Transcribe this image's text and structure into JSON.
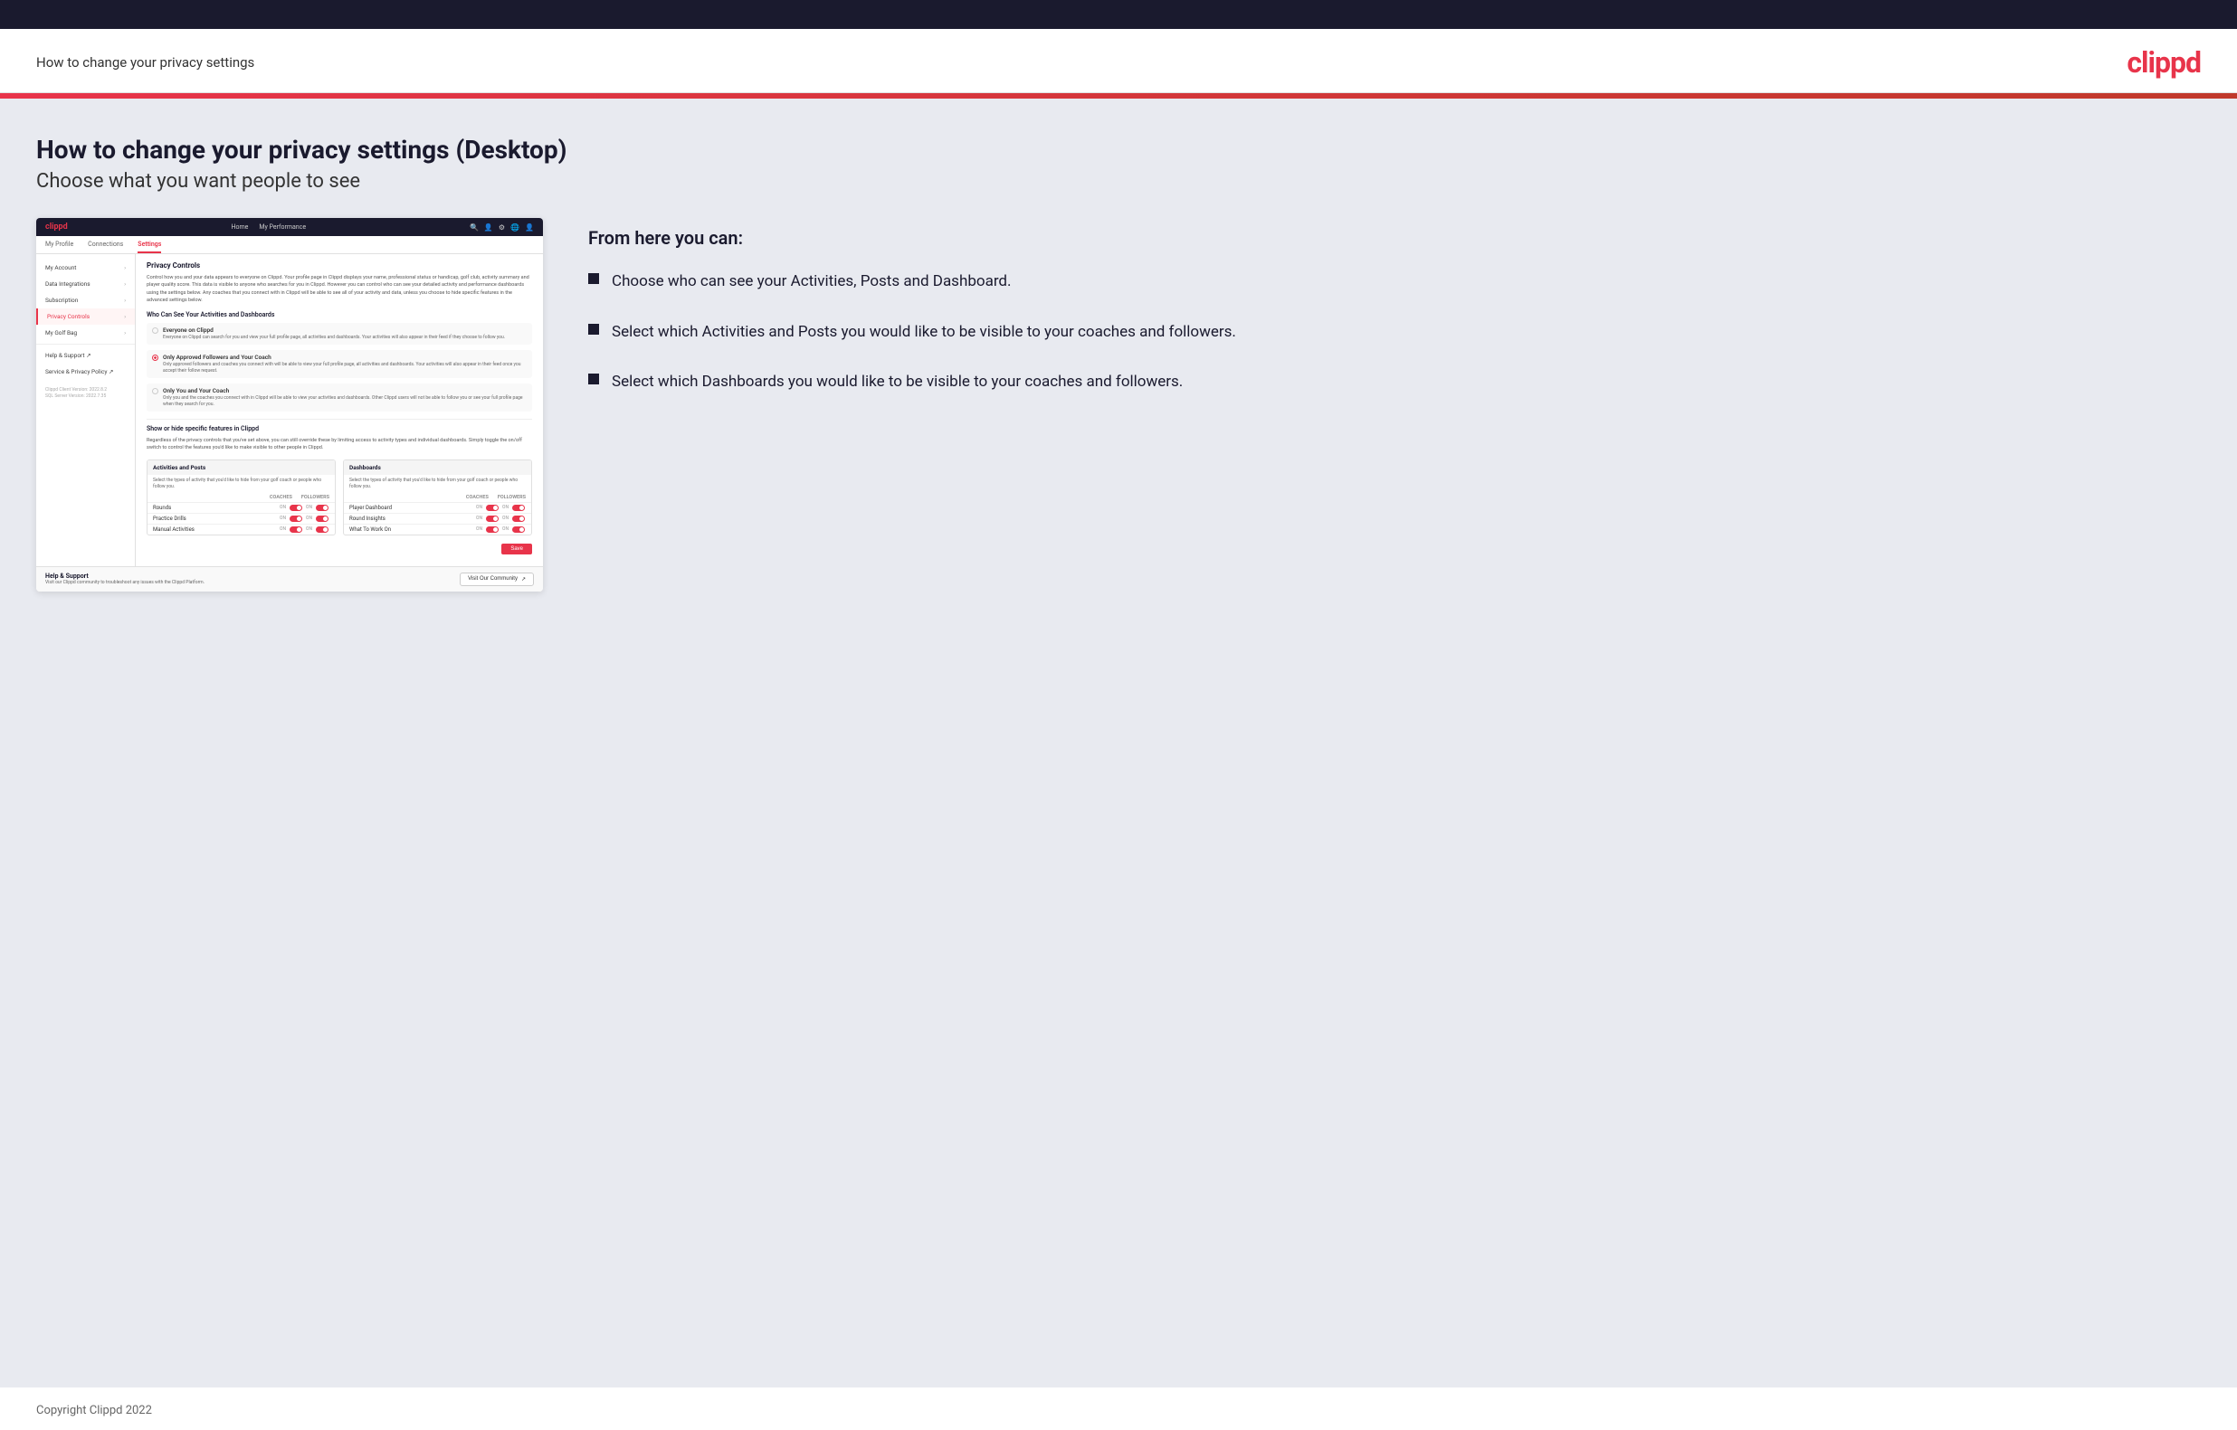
{
  "header": {
    "title": "How to change your privacy settings",
    "logo": "clippd"
  },
  "page": {
    "heading": "How to change your privacy settings (Desktop)",
    "subheading": "Choose what you want people to see"
  },
  "right_panel": {
    "from_here_title": "From here you can:",
    "bullets": [
      "Choose who can see your Activities, Posts and Dashboard.",
      "Select which Activities and Posts you would like to be visible to your coaches and followers.",
      "Select which Dashboards you would like to be visible to your coaches and followers."
    ]
  },
  "mini_app": {
    "nav": {
      "logo": "clippd",
      "links": [
        "Home",
        "My Performance"
      ],
      "icons": [
        "🔍",
        "👤",
        "⚙",
        "🌐",
        "👤"
      ]
    },
    "tabs": [
      "My Profile",
      "Connections",
      "Settings"
    ],
    "active_tab": "Settings",
    "sidebar": {
      "items": [
        {
          "label": "My Account",
          "active": false
        },
        {
          "label": "Data Integrations",
          "active": false
        },
        {
          "label": "Subscription",
          "active": false
        },
        {
          "label": "Privacy Controls",
          "active": true
        },
        {
          "label": "My Golf Bag",
          "active": false
        },
        {
          "label": "Help & Support",
          "active": false,
          "icon": "↗"
        },
        {
          "label": "Service & Privacy Policy",
          "active": false,
          "icon": "↗"
        }
      ],
      "version": "Clippd Client Version: 2022.8.2\nSQL Server Version: 2022.7.35"
    },
    "content": {
      "section_title": "Privacy Controls",
      "description": "Control how you and your data appears to everyone on Clippd. Your profile page in Clippd displays your name, professional status or handicap, golf club, activity summary and player quality score. This data is visible to anyone who searches for you in Clippd. However you can control who can see your detailed activity and performance dashboards using the settings below. Any coaches that you connect with in Clippd will be able to see all of your activity and data, unless you choose to hide specific features in the advanced settings below.",
      "who_can_see_title": "Who Can See Your Activities and Dashboards",
      "radio_options": [
        {
          "label": "Everyone on Clippd",
          "description": "Everyone on Clippd can search for you and view your full profile page, all activities and dashboards. Your activities will also appear in their feed if they choose to follow you.",
          "selected": false
        },
        {
          "label": "Only Approved Followers and Your Coach",
          "description": "Only approved followers and coaches you connect with will be able to view your full profile page, all activities and dashboards. Your activities will also appear in their feed once you accept their follow request.",
          "selected": true
        },
        {
          "label": "Only You and Your Coach",
          "description": "Only you and the coaches you connect with in Clippd will be able to view your activities and dashboards. Other Clippd users will not be able to follow you or see your full profile page when they search for you.",
          "selected": false
        }
      ],
      "show_hide_title": "Show or hide specific features in Clippd",
      "show_hide_desc": "Regardless of the privacy controls that you've set above, you can still override these by limiting access to activity types and individual dashboards. Simply toggle the on/off switch to control the features you'd like to make visible to other people in Clippd.",
      "activities_section": {
        "title": "Activities and Posts",
        "description": "Select the types of activity that you'd like to hide from your golf coach or people who follow you.",
        "columns": [
          "COACHES",
          "FOLLOWERS"
        ],
        "rows": [
          {
            "label": "Rounds",
            "coaches_on": true,
            "followers_on": true
          },
          {
            "label": "Practice Drills",
            "coaches_on": true,
            "followers_on": true
          },
          {
            "label": "Manual Activities",
            "coaches_on": true,
            "followers_on": true
          }
        ]
      },
      "dashboards_section": {
        "title": "Dashboards",
        "description": "Select the types of activity that you'd like to hide from your golf coach or people who follow you.",
        "columns": [
          "COACHES",
          "FOLLOWERS"
        ],
        "rows": [
          {
            "label": "Player Dashboard",
            "coaches_on": true,
            "followers_on": true
          },
          {
            "label": "Round Insights",
            "coaches_on": true,
            "followers_on": true
          },
          {
            "label": "What To Work On",
            "coaches_on": true,
            "followers_on": true
          }
        ]
      },
      "save_label": "Save",
      "help": {
        "title": "Help & Support",
        "description": "Visit our Clippd community to troubleshoot any issues with the Clippd Platform.",
        "button_label": "Visit Our Community"
      }
    }
  },
  "footer": {
    "copyright": "Copyright Clippd 2022"
  }
}
